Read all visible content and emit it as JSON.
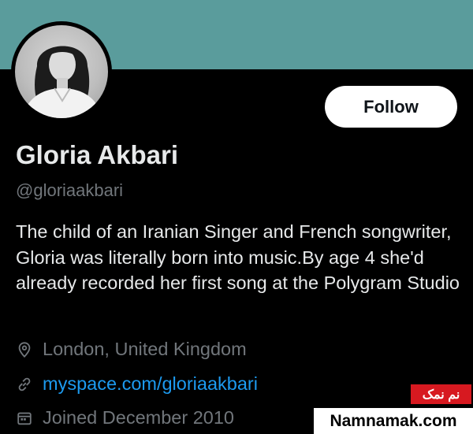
{
  "profile": {
    "name": "Gloria Akbari",
    "handle": "@gloriaakbari",
    "bio": "The child of an Iranian Singer and French songwriter, Gloria was literally born into music.By age 4 she'd already recorded her first song at the Polygram Studio",
    "location": "London, United Kingdom",
    "website": "myspace.com/gloriaakbari",
    "joined": "Joined December 2010"
  },
  "actions": {
    "follow_label": "Follow"
  },
  "icons": {
    "location": "location-pin-icon",
    "website": "link-icon",
    "joined": "calendar-icon"
  },
  "watermark": {
    "persian": "نم نمک",
    "site": "Namnamak.com"
  },
  "colors": {
    "banner": "#5a9c9c",
    "background": "#000000",
    "link": "#1d9bf0",
    "muted": "#71767b",
    "watermark_red": "#d71920"
  }
}
